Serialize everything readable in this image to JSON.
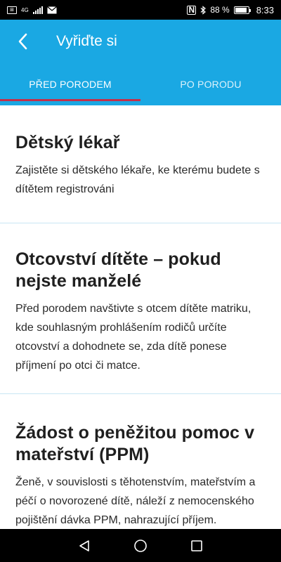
{
  "status_bar": {
    "network_type": "4G",
    "nfc_label": "N",
    "battery_text": "88 %",
    "battery_level": 0.88,
    "time": "8:33"
  },
  "app_bar": {
    "title": "Vyřiďte si",
    "back_icon": "chevron-left-icon",
    "color": "#1aa8e3"
  },
  "tabs": [
    {
      "label": "PŘED PORODEM",
      "active": true
    },
    {
      "label": "PO PORODU",
      "active": false
    }
  ],
  "tab_indicator_color": "#c3304a",
  "cards": [
    {
      "title": "Dětský lékař",
      "body": "Zajistěte si dětského lékaře, ke kterému budete s dítětem registrováni"
    },
    {
      "title": "Otcovství dítěte – pokud nejste manželé",
      "body": "Před porodem navštivte s otcem dítěte matriku, kde souhlasným prohlášením rodičů určíte otcovství a dohodnete se, zda dítě ponese příjmení po otci či matce."
    },
    {
      "title": "Žádost o peněžitou pomoc v mateřství (PPM)",
      "body": "Ženě, v souvislosti s těhotenstvím, mateřstvím a péčí o novorozené dítě, náleží z nemocenského pojištění dávka PPM, nahrazující příjem."
    }
  ],
  "nav_bar": {
    "buttons": [
      "back-triangle-icon",
      "home-circle-icon",
      "recents-square-icon"
    ]
  }
}
